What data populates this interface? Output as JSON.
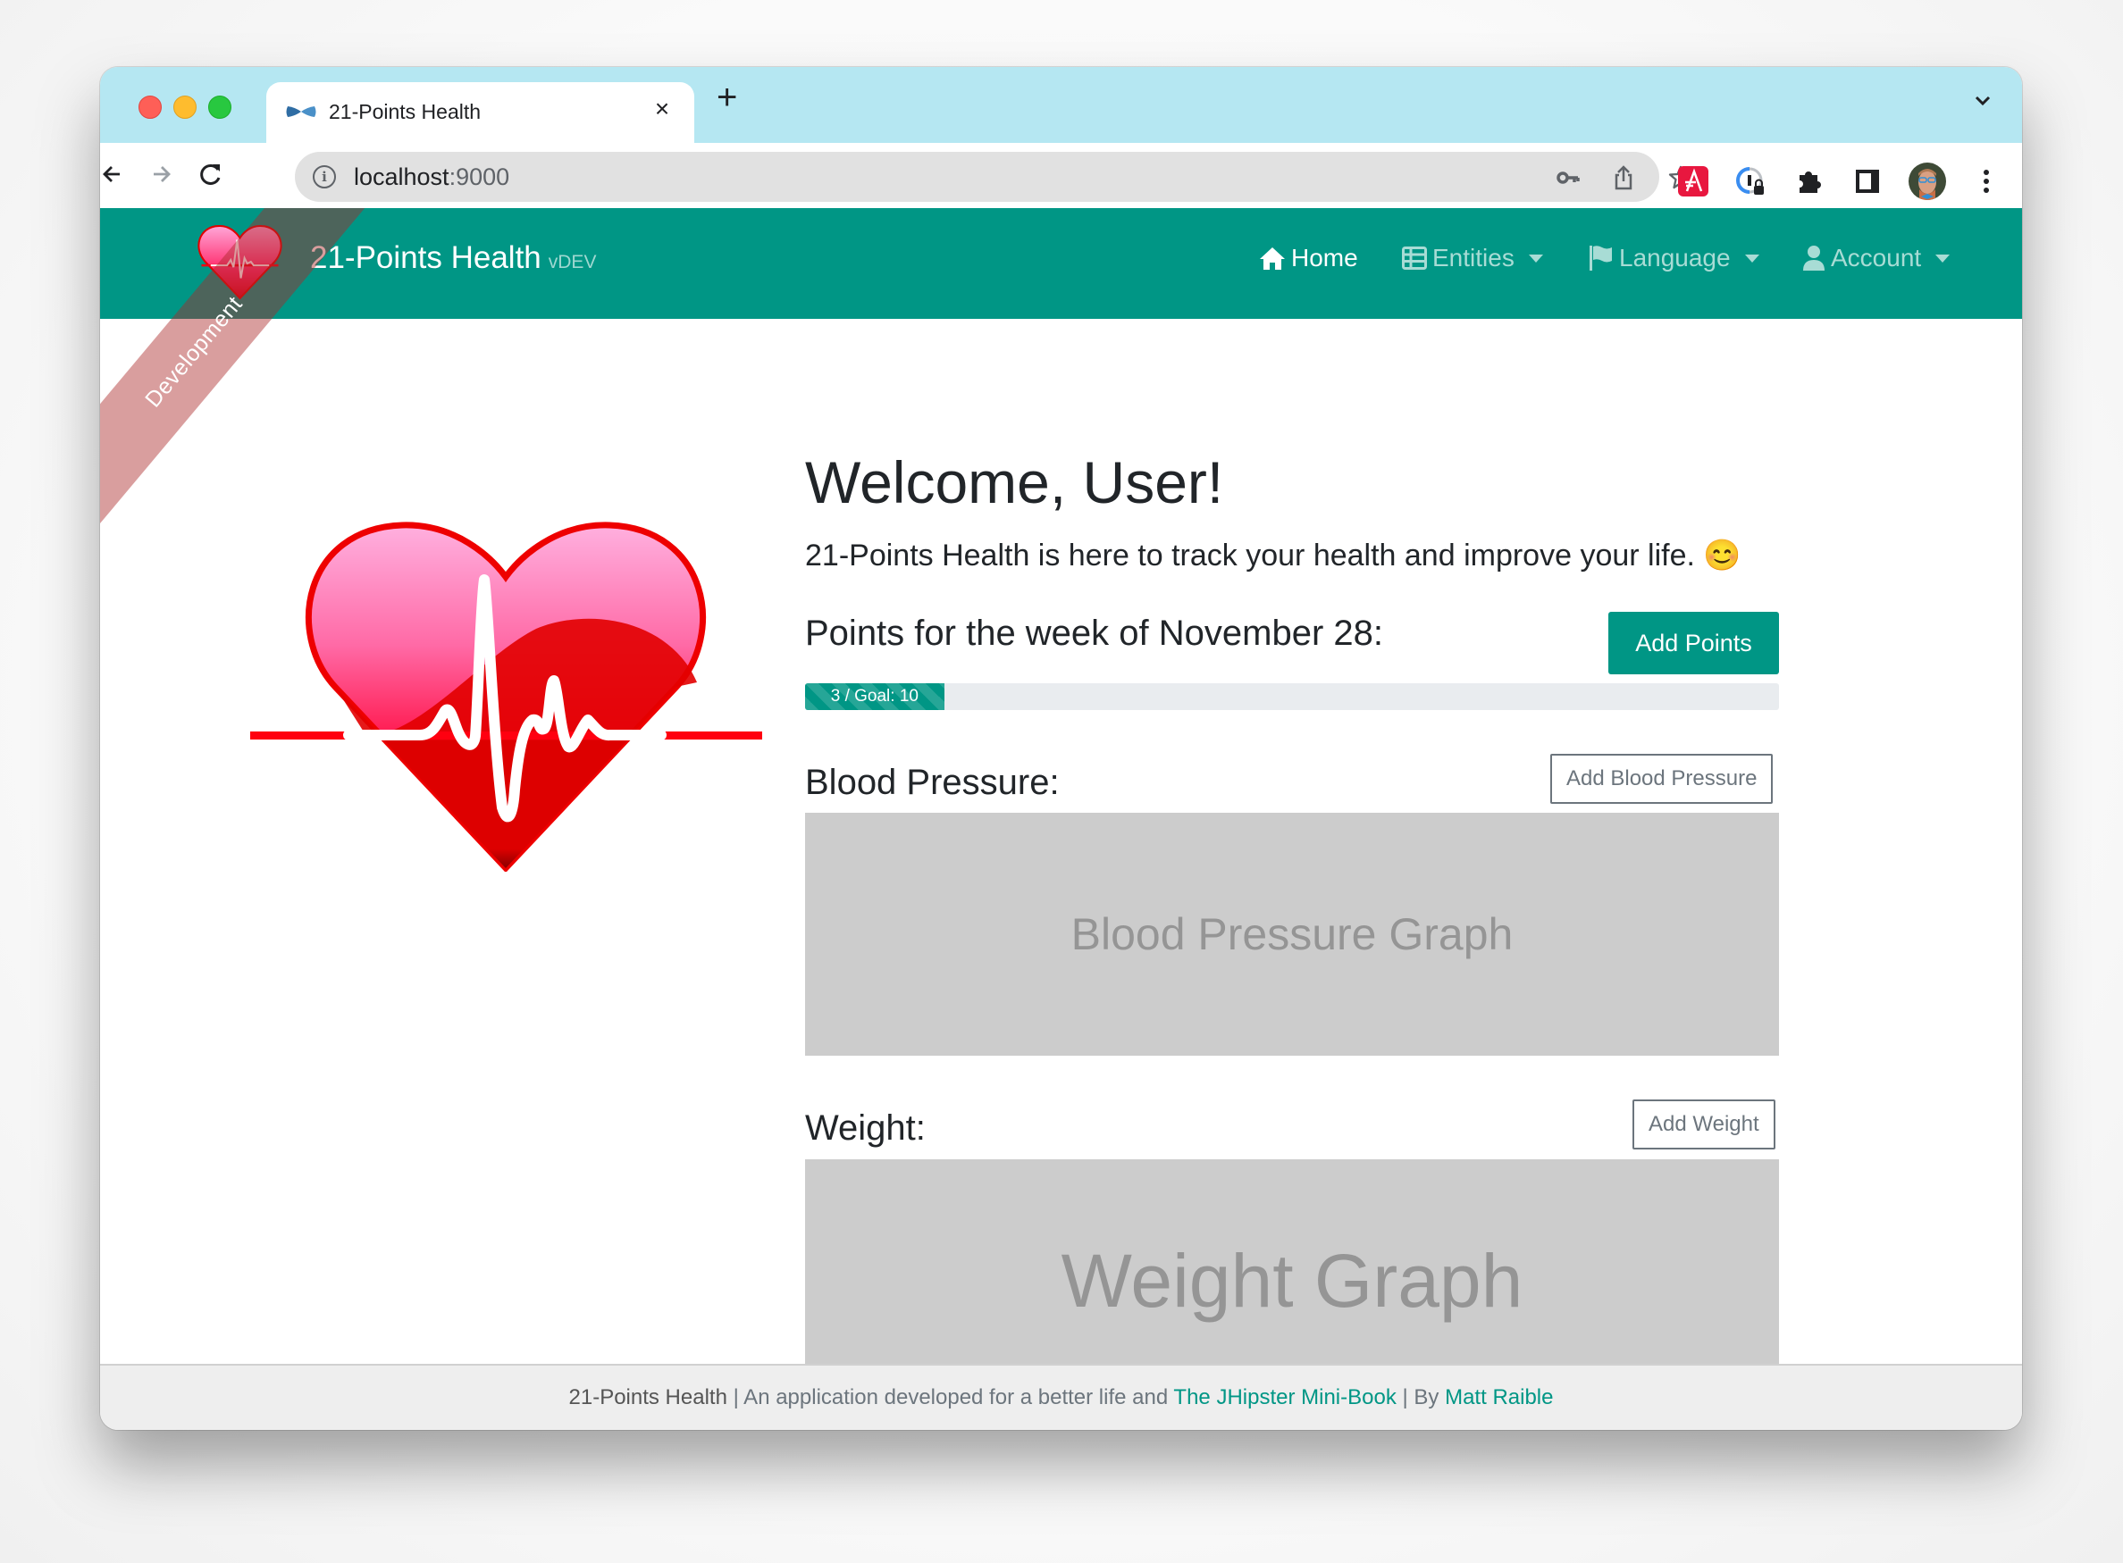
{
  "browser": {
    "tab_title": "21-Points Health",
    "tab_close": "×",
    "new_tab": "+",
    "url_host": "localhost",
    "url_port": ":9000",
    "toolbar_icons": [
      "back-icon",
      "forward-icon",
      "reload-icon",
      "site-info-icon",
      "password-key-icon",
      "share-icon",
      "bookmark-star-icon",
      "extension-a-icon",
      "extension-password-icon",
      "extensions-puzzle-icon",
      "side-panel-icon",
      "profile-avatar",
      "more-menu-icon"
    ]
  },
  "navbar": {
    "brand": "21-Points Health",
    "version": "vDEV",
    "ribbon": "Development",
    "links": [
      {
        "label": "Home",
        "icon": "home-icon",
        "active": true
      },
      {
        "label": "Entities",
        "icon": "table-icon",
        "dropdown": true
      },
      {
        "label": "Language",
        "icon": "flag-icon",
        "dropdown": true
      },
      {
        "label": "Account",
        "icon": "user-icon",
        "dropdown": true
      }
    ]
  },
  "main": {
    "welcome": "Welcome, User!",
    "lead": "21-Points Health is here to track your health and improve your life. 😊",
    "points": {
      "title": "Points for the week of November 28:",
      "add_button": "Add Points",
      "progress_label": "3 / Goal: 10",
      "value": 3,
      "max": 21
    },
    "blood_pressure": {
      "title": "Blood Pressure:",
      "add_button": "Add Blood Pressure",
      "graph_placeholder": "Blood Pressure Graph"
    },
    "weight": {
      "title": "Weight:",
      "add_button": "Add Weight",
      "graph_placeholder": "Weight Graph"
    }
  },
  "footer": {
    "app_name": "21-Points Health",
    "sep1": " | An application developed for a better life and ",
    "book_link": "The JHipster Mini-Book",
    "sep2": " | By ",
    "author_link": "Matt Raible"
  },
  "colors": {
    "primary": "#009685",
    "tabstrip": "#b5e7f2",
    "graph_bg": "#cccccc"
  }
}
